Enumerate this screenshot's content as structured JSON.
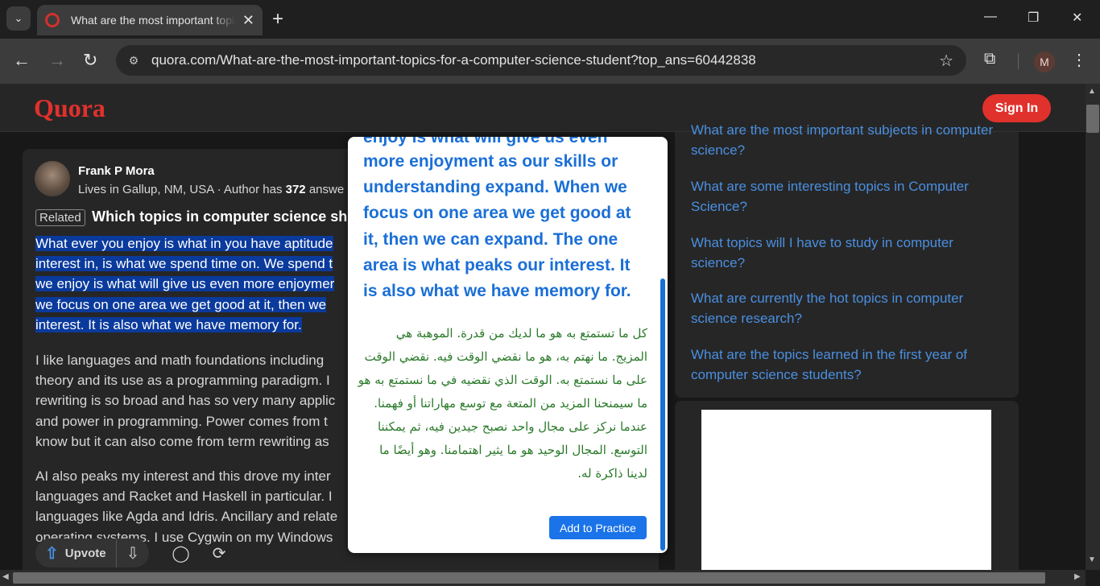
{
  "browser": {
    "tab_title": "What are the most important topics for a computer science student?",
    "url": "quora.com/What-are-the-most-important-topics-for-a-computer-science-student?top_ans=60442838",
    "profile_initial": "M"
  },
  "header": {
    "logo": "Quora",
    "signin_label": "Sign In"
  },
  "answer": {
    "author_name": "Frank P Mora",
    "author_meta_prefix": "Lives in Gallup, NM, USA · Author has ",
    "author_answer_count": "372",
    "author_meta_suffix": " answe",
    "related_badge": "Related",
    "related_question": "Which topics in computer science sh",
    "p1": [
      "What ever you enjoy is what in you have aptitude",
      "interest in, is what we spend time on. We spend t",
      "we enjoy is what will give us even more enjoymer",
      "we focus on one area we get good at it, then we",
      "interest. It is also what we have memory for."
    ],
    "p2": [
      "I like languages and math foundations including",
      "theory and its use as a programming paradigm. I",
      "rewriting is so broad and has so very many applic",
      "and power in programming. Power comes from t",
      "know but it can also come from term rewriting as"
    ],
    "p3": [
      "AI also peaks my interest and this drove my inter",
      "languages and Racket and Haskell in particular. I",
      "languages like Agda and Idris. Ancillary and relate",
      "operating systems. I use Cygwin on my Windows"
    ],
    "upvote_label": "Upvote"
  },
  "sidebar": {
    "links": [
      "What are the most important subjects in computer science?",
      "What are some interesting topics in Computer Science?",
      "What topics will I have to study in computer science?",
      "What are currently the hot topics in computer science research?",
      "What are the topics learned in the first year of computer science students?"
    ]
  },
  "popup": {
    "english_lines": [
      "enjoy is what will give us even",
      "more enjoyment as our skills or",
      "understanding expand. When we",
      "focus on one area we get good at",
      "it, then we can expand. The one",
      "area is what peaks our interest. It",
      "is also what we have memory for."
    ],
    "arabic_lines": [
      "كل ما تستمتع به هو ما لديك من قدرة. الموهبة هي",
      "المزيج. ما نهتم به، هو ما نقضي الوقت فيه. نقضي الوقت",
      "على ما نستمتع به. الوقت الذي نقضيه في ما نستمتع به هو",
      "ما سيمنحنا المزيد من المتعة مع توسع مهاراتنا أو فهمنا.",
      "عندما نركز على مجال واحد نصبح جيدين فيه، ثم يمكننا",
      "التوسع. المجال الوحيد هو ما يثير اهتمامنا. وهو أيضًا ما",
      "لدينا ذاكرة له."
    ],
    "add_button": "Add to Practice"
  },
  "colors": {
    "brand": "#e0312d",
    "link": "#4a8fe0",
    "popup_en": "#1a6fd6",
    "popup_ar": "#2a7a2a",
    "highlight": "#0a3a9c"
  },
  "icons": [
    "chevron-down-icon",
    "quora-favicon",
    "close-icon",
    "plus-icon",
    "minimize-icon",
    "restore-icon",
    "back-icon",
    "forward-icon",
    "reload-icon",
    "site-info-icon",
    "star-icon",
    "extensions-icon",
    "kebab-icon",
    "upvote-icon",
    "downvote-icon",
    "comment-icon",
    "share-icon"
  ]
}
